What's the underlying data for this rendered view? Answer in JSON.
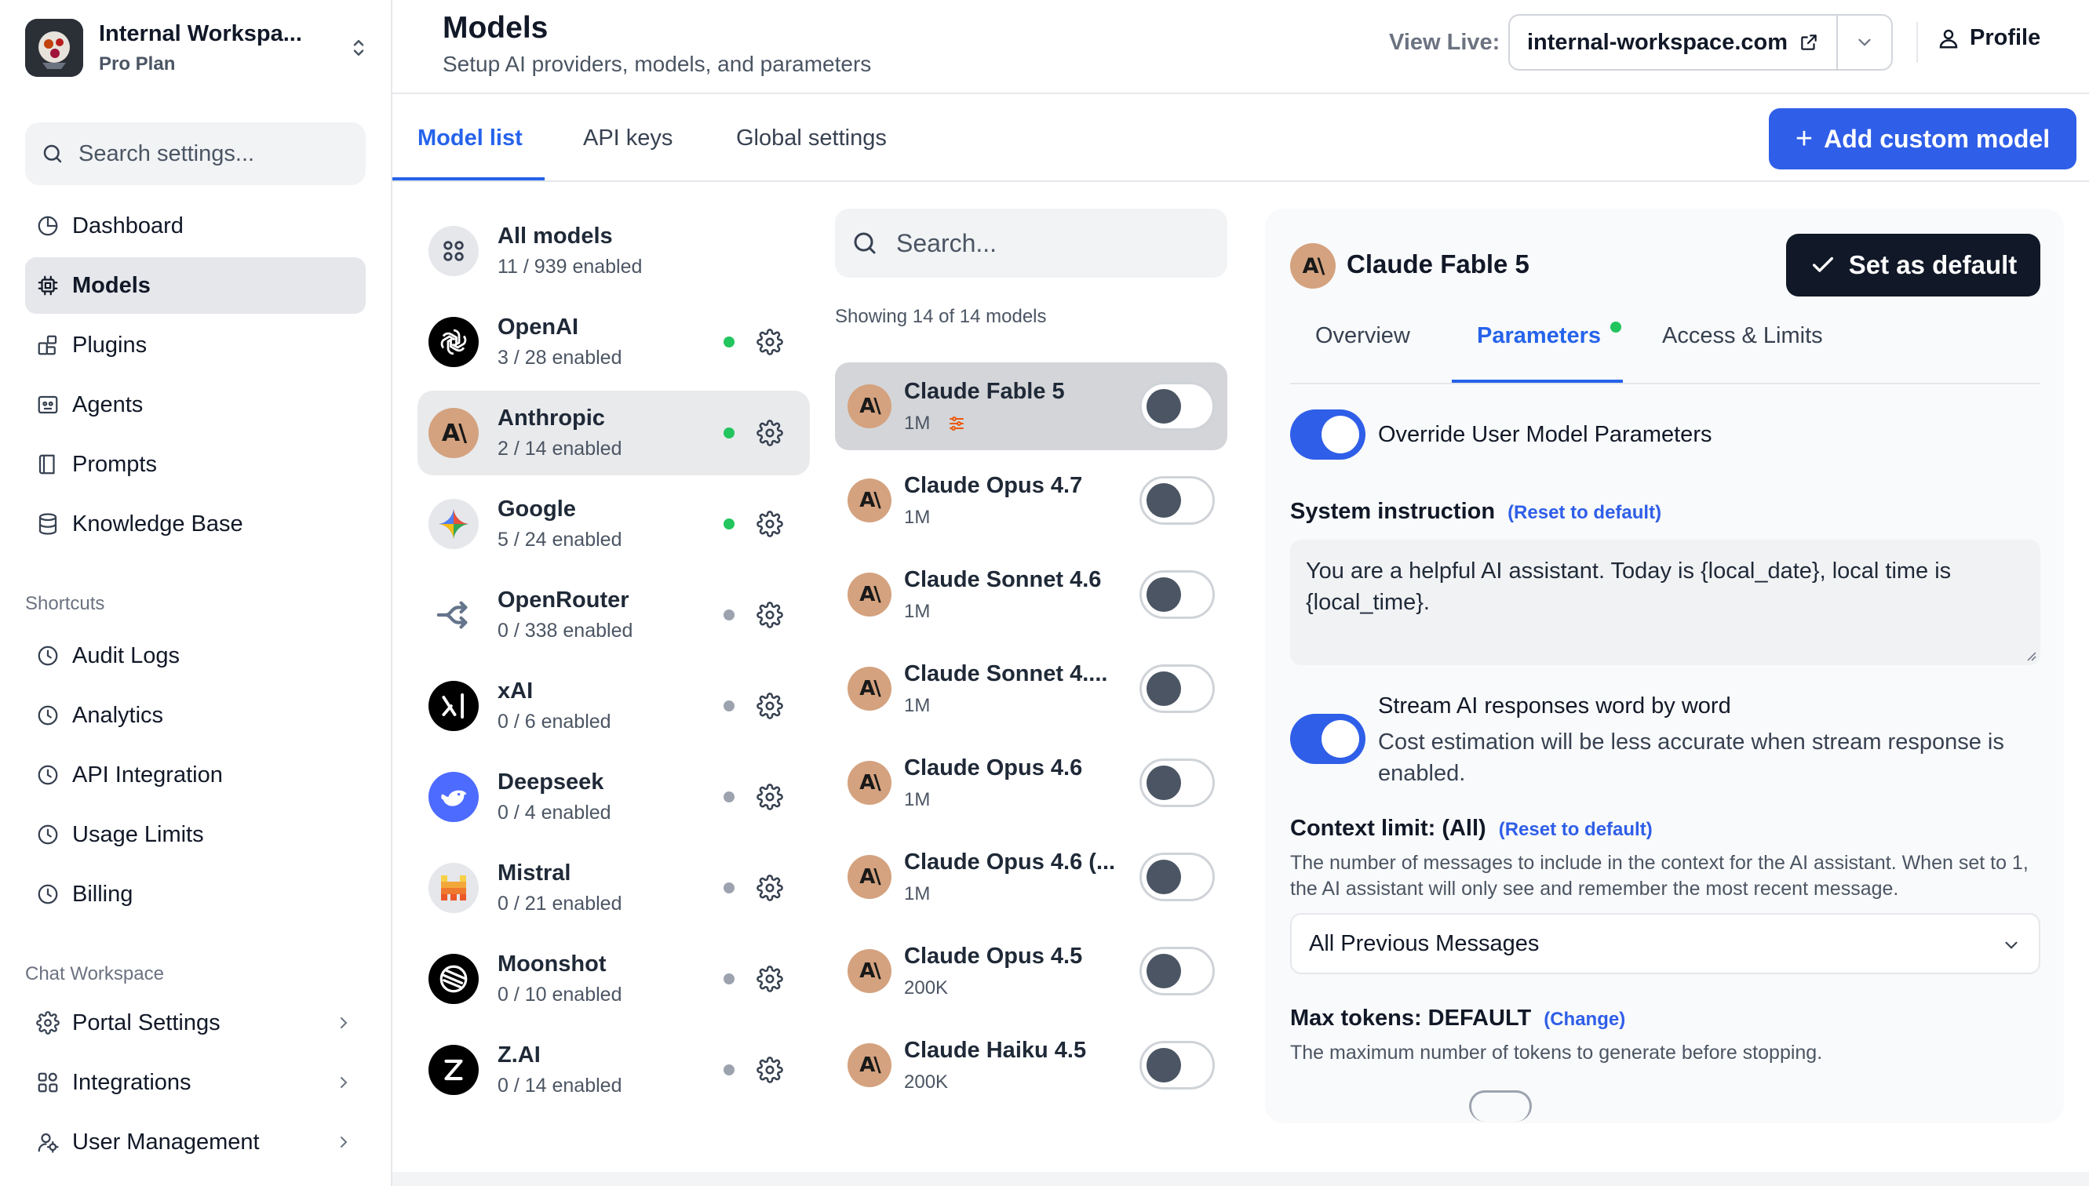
{
  "workspace": {
    "name": "Internal Workspa...",
    "plan": "Pro Plan"
  },
  "sidebar": {
    "search_placeholder": "Search settings...",
    "items": [
      {
        "label": "Dashboard"
      },
      {
        "label": "Models"
      },
      {
        "label": "Plugins"
      },
      {
        "label": "Agents"
      },
      {
        "label": "Prompts"
      },
      {
        "label": "Knowledge Base"
      }
    ],
    "shortcuts_label": "Shortcuts",
    "shortcuts": [
      {
        "label": "Audit Logs"
      },
      {
        "label": "Analytics"
      },
      {
        "label": "API Integration"
      },
      {
        "label": "Usage Limits"
      },
      {
        "label": "Billing"
      }
    ],
    "chat_workspace_label": "Chat Workspace",
    "chat_workspace": [
      {
        "label": "Portal Settings"
      },
      {
        "label": "Integrations"
      },
      {
        "label": "User Management"
      }
    ]
  },
  "header": {
    "title": "Models",
    "subtitle": "Setup AI providers, models, and parameters",
    "view_live_label": "View Live:",
    "view_live_url": "internal-workspace.com",
    "profile_label": "Profile"
  },
  "tabs": [
    {
      "label": "Model list"
    },
    {
      "label": "API keys"
    },
    {
      "label": "Global settings"
    }
  ],
  "add_custom_model_label": "Add custom model",
  "providers": [
    {
      "name": "All models",
      "count": "11 / 939 enabled"
    },
    {
      "name": "OpenAI",
      "count": "3 / 28 enabled",
      "status": "active"
    },
    {
      "name": "Anthropic",
      "count": "2 / 14 enabled",
      "status": "active"
    },
    {
      "name": "Google",
      "count": "5 / 24 enabled",
      "status": "active"
    },
    {
      "name": "OpenRouter",
      "count": "0 / 338 enabled",
      "status": "inactive"
    },
    {
      "name": "xAI",
      "count": "0 / 6 enabled",
      "status": "inactive"
    },
    {
      "name": "Deepseek",
      "count": "0 / 4 enabled",
      "status": "inactive"
    },
    {
      "name": "Mistral",
      "count": "0 / 21 enabled",
      "status": "inactive"
    },
    {
      "name": "Moonshot",
      "count": "0 / 10 enabled",
      "status": "inactive"
    },
    {
      "name": "Z.AI",
      "count": "0 / 14 enabled",
      "status": "inactive"
    }
  ],
  "models": {
    "search_placeholder": "Search...",
    "showing": "Showing 14 of 14 models",
    "items": [
      {
        "name": "Claude Fable 5",
        "context": "1M"
      },
      {
        "name": "Claude Opus 4.7",
        "context": "1M"
      },
      {
        "name": "Claude Sonnet 4.6",
        "context": "1M"
      },
      {
        "name": "Claude Sonnet 4....",
        "context": "1M"
      },
      {
        "name": "Claude Opus 4.6",
        "context": "1M"
      },
      {
        "name": "Claude Opus 4.6 (...",
        "context": "1M"
      },
      {
        "name": "Claude Opus 4.5",
        "context": "200K"
      },
      {
        "name": "Claude Haiku 4.5",
        "context": "200K"
      }
    ]
  },
  "detail": {
    "title": "Claude Fable 5",
    "set_default_label": "Set as default",
    "tabs": [
      {
        "label": "Overview"
      },
      {
        "label": "Parameters"
      },
      {
        "label": "Access & Limits"
      }
    ],
    "override_label": "Override User Model Parameters",
    "system_instruction_label": "System instruction",
    "reset_label": "(Reset to default)",
    "system_instruction_value": "You are a helpful AI assistant. Today is {local_date}, local time is {local_time}.",
    "stream_label": "Stream AI responses word by word",
    "stream_note": "Cost estimation will be less accurate when stream response is enabled.",
    "context_limit_label": "Context limit: (All)",
    "context_reset_label": "(Reset to default)",
    "context_help": "The number of messages to include in the context for the AI assistant. When set to 1, the AI assistant will only see and remember the most recent message.",
    "context_select_value": "All Previous Messages",
    "max_tokens_label": "Max tokens: DEFAULT",
    "max_tokens_change": "(Change)",
    "max_tokens_help": "The maximum number of tokens to generate before stopping."
  },
  "colors": {
    "accent": "#2f5ee8",
    "active_status": "#22c55e",
    "inactive_status": "#9ca3af",
    "anthropic_brand": "#d4a27f",
    "primary_dark": "#111827"
  },
  "icons": {
    "sidebar": [
      "dashboard-icon",
      "chip-icon",
      "plugin-icon",
      "agent-icon",
      "book-icon",
      "database-icon",
      "clock-icon",
      "gear-icon",
      "integrations-icon",
      "users-icon"
    ]
  }
}
